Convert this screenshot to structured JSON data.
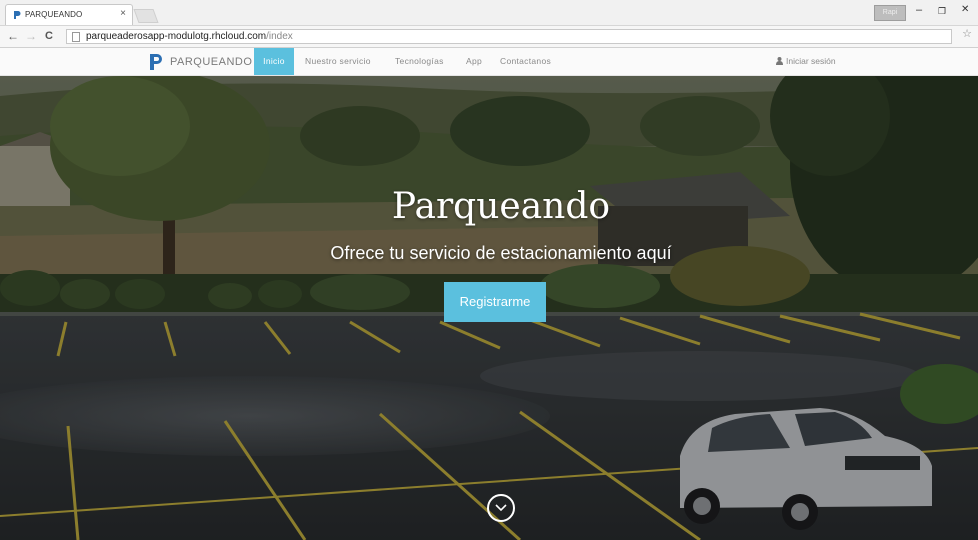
{
  "browser": {
    "tab_title": "PARQUEANDO",
    "tab_close": "×",
    "user_badge": "Rapi",
    "url_main": "parqueaderosapp-modulotg.rhcloud.com",
    "url_path": "/index",
    "win_min": "–",
    "win_restore": "❐",
    "win_close": "✕",
    "back": "←",
    "forward": "→",
    "reload": "C",
    "star": "☆"
  },
  "navbar": {
    "brand": "PARQUEANDO",
    "items": [
      {
        "label": "Inicio",
        "active": true
      },
      {
        "label": "Nuestro servicio",
        "active": false
      },
      {
        "label": "Tecnologías",
        "active": false
      },
      {
        "label": "App",
        "active": false
      },
      {
        "label": "Contactanos",
        "active": false
      }
    ],
    "login": "Iniciar sesión"
  },
  "hero": {
    "title": "Parqueando",
    "subtitle": "Ofrece tu servicio de estacionamiento aquí",
    "cta": "Registrarme"
  },
  "colors": {
    "accent": "#5bc0de",
    "logo": "#2c6fb3"
  },
  "icons": [
    "chevron-down-icon",
    "user-icon",
    "star-icon",
    "page-icon",
    "parking-logo-icon"
  ]
}
